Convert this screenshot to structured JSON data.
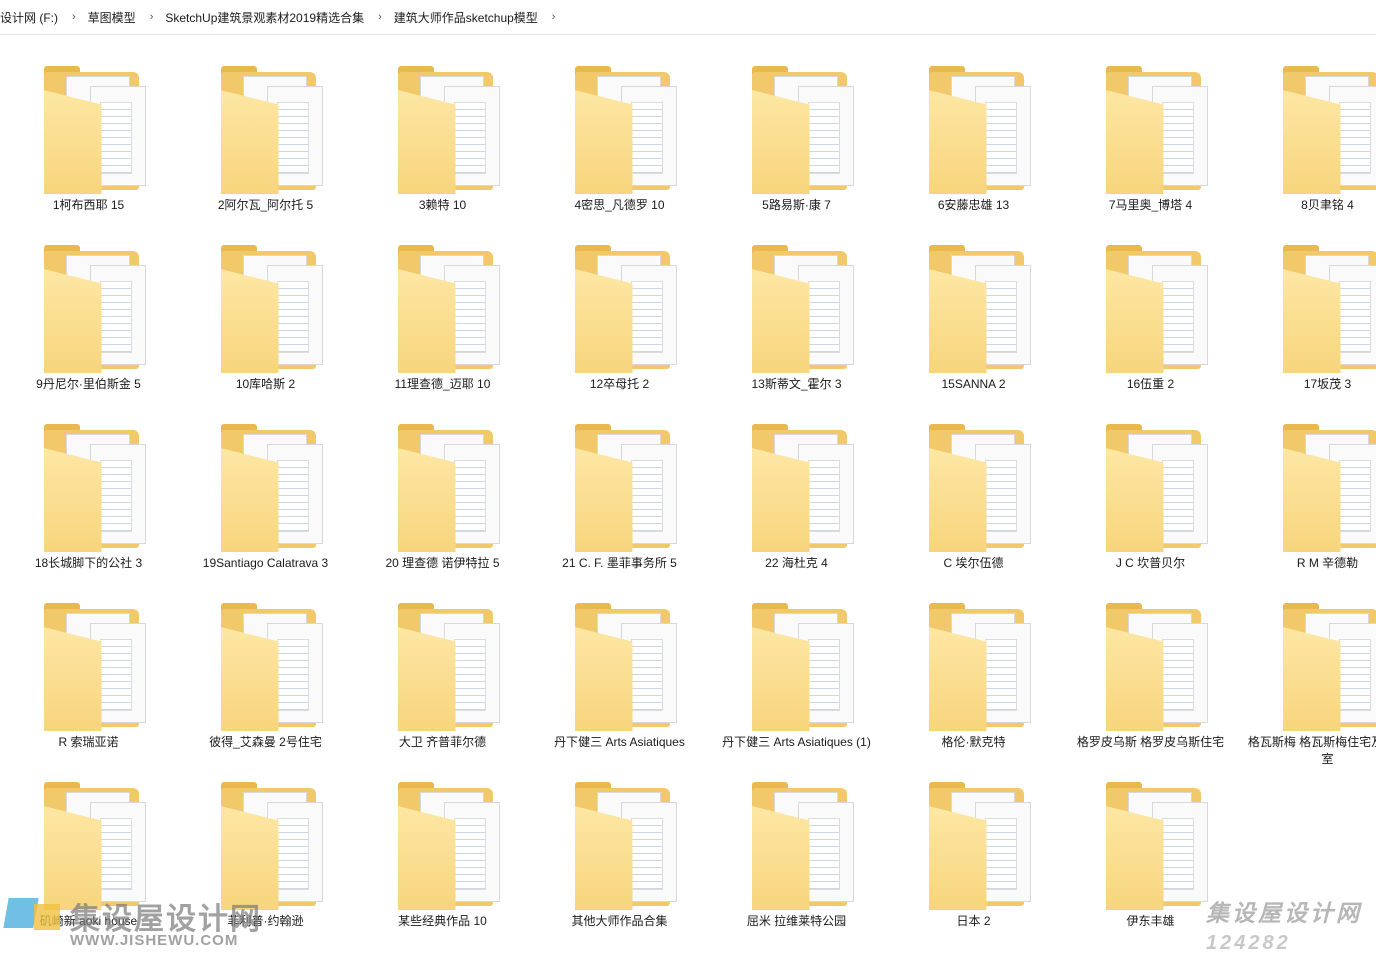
{
  "breadcrumb": [
    "设计网 (F:)",
    "草图模型",
    "SketchUp建筑景观素材2019精选合集",
    "建筑大师作品sketchup模型"
  ],
  "breadcrumb_separator": "›",
  "folders": [
    "1柯布西耶 15",
    "2阿尔瓦_阿尔托 5",
    "3赖特 10",
    "4密思_凡德罗 10",
    "5路易斯·康 7",
    "6安藤忠雄 13",
    "7马里奥_博塔 4",
    "8贝聿铭 4",
    "9丹尼尔·里伯斯金 5",
    "10库哈斯 2",
    "11理查德_迈耶 10",
    "12卒母托 2",
    "13斯蒂文_霍尔 3",
    "15SANNA 2",
    "16伍重 2",
    "17坂茂 3",
    "18长城脚下的公社 3",
    "19Santiago Calatrava 3",
    "20 理查德 诺伊特拉 5",
    "21 C. F. 墨菲事务所 5",
    "22 海杜克 4",
    "C 埃尔伍德",
    "J C 坎普贝尔",
    "R M 辛德勒",
    "R 索瑞亚诺",
    "彼得_艾森曼 2号住宅",
    "大卫 齐普菲尔德",
    "丹下健三 Arts Asiatiques",
    "丹下健三 Arts Asiatiques (1)",
    "格伦·默克特",
    "格罗皮乌斯 格罗皮乌斯住宅",
    "格瓦斯梅 格瓦斯梅住宅及工作室",
    "矶崎新 aoki house",
    "菲利普·约翰逊",
    "某些经典作品 10",
    "其他大师作品合集",
    "屈米 拉维莱特公园",
    "日本 2",
    "伊东丰雄"
  ],
  "watermark": {
    "site_cn": "集设屋设计网",
    "site_en": "WWW.JISHEWU.COM",
    "stamp_cn": "集设屋设计网",
    "stamp_num": "124282"
  }
}
